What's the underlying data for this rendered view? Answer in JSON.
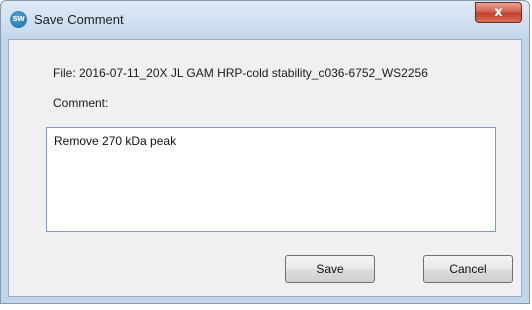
{
  "window": {
    "title": "Save Comment",
    "app_icon_text": "SW",
    "close_glyph": "x"
  },
  "dialog": {
    "file_line": "File: 2016-07-11_20X JL GAM HRP-cold stability_c036-6752_WS2256",
    "comment_label": "Comment:",
    "comment_value": "Remove 270 kDa peak"
  },
  "buttons": {
    "save_label": "Save",
    "cancel_label": "Cancel"
  },
  "colors": {
    "close_button": "#c94a36",
    "input_border": "#7a9cc9",
    "client_background": "#f0f0f0"
  }
}
